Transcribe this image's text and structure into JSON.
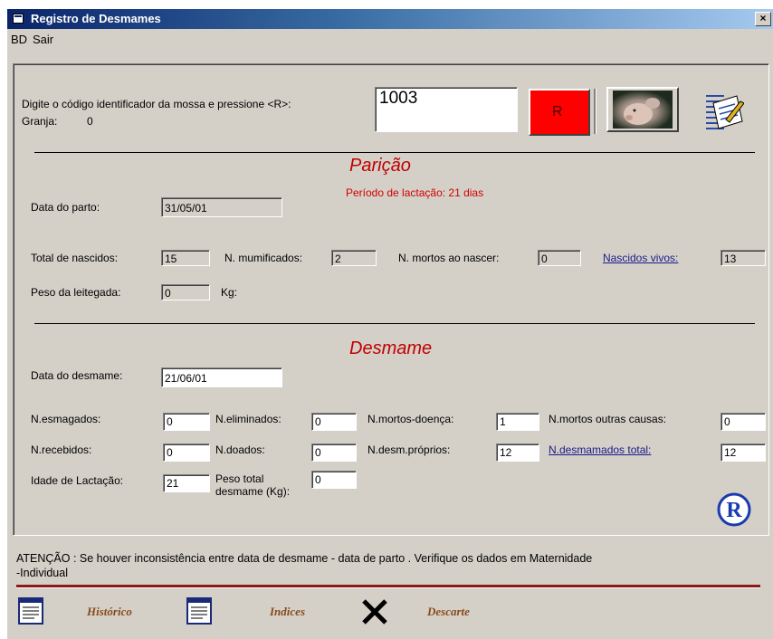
{
  "window": {
    "title": "Registro de Desmames",
    "close_label": "×"
  },
  "menu": [
    {
      "label": "BD"
    },
    {
      "label": "Sair"
    }
  ],
  "search": {
    "prompt": "Digite o código identificador da mossa  e pressione <R>:",
    "value": "1003",
    "granja_label": "Granja:",
    "granja_value": "0",
    "r_button": "R"
  },
  "paricao": {
    "title": "Parição",
    "lactacao_period": "Período de lactação:  21 dias",
    "data_parto_label": "Data do parto:",
    "data_parto": "31/05/01",
    "total_nascidos_label": "Total de nascidos:",
    "total_nascidos": "15",
    "mumificados_label": "N. mumificados:",
    "mumificados": "2",
    "mortos_nascer_label": "N. mortos ao nascer:",
    "mortos_nascer": "0",
    "nascidos_vivos_label": "Nascidos vivos:",
    "nascidos_vivos": "13",
    "peso_leitegada_label": "Peso da leitegada:",
    "peso_leitegada": "0",
    "kg_label": "Kg:"
  },
  "desmame": {
    "title": "Desmame",
    "data_desmame_label": "Data do desmame:",
    "data_desmame": "21/06/01",
    "esmagados_label": "N.esmagados:",
    "esmagados": "0",
    "eliminados_label": "N.eliminados:",
    "eliminados": "0",
    "mortos_doenca_label": "N.mortos-doença:",
    "mortos_doenca": "1",
    "mortos_outras_label": "N.mortos outras causas:",
    "mortos_outras": "0",
    "recebidos_label": "N.recebidos:",
    "recebidos": "0",
    "doados_label": "N.doados:",
    "doados": "0",
    "desm_proprios_label": "N.desm.próprios:",
    "desm_proprios": "12",
    "desmamados_total_label": "N.desmamados total:",
    "desmamados_total": "12",
    "idade_lactacao_label": "Idade de Lactação:",
    "idade_lactacao": "21",
    "peso_total_label_1": "Peso total",
    "peso_total_label_2": "desmame (Kg):",
    "peso_total": "0"
  },
  "warning": {
    "line1": "ATENÇÃO : Se houver inconsistência entre data de desmame - data de parto . Verifique os dados em Maternidade",
    "line2": "-Individual"
  },
  "bottom": {
    "historico": "Histórico",
    "indices": "Indices",
    "descarte": "Descarte"
  },
  "colors": {
    "accent_red": "#c00000",
    "r_button_bg": "#ff0000",
    "bottom_text": "#8a4a1a"
  }
}
